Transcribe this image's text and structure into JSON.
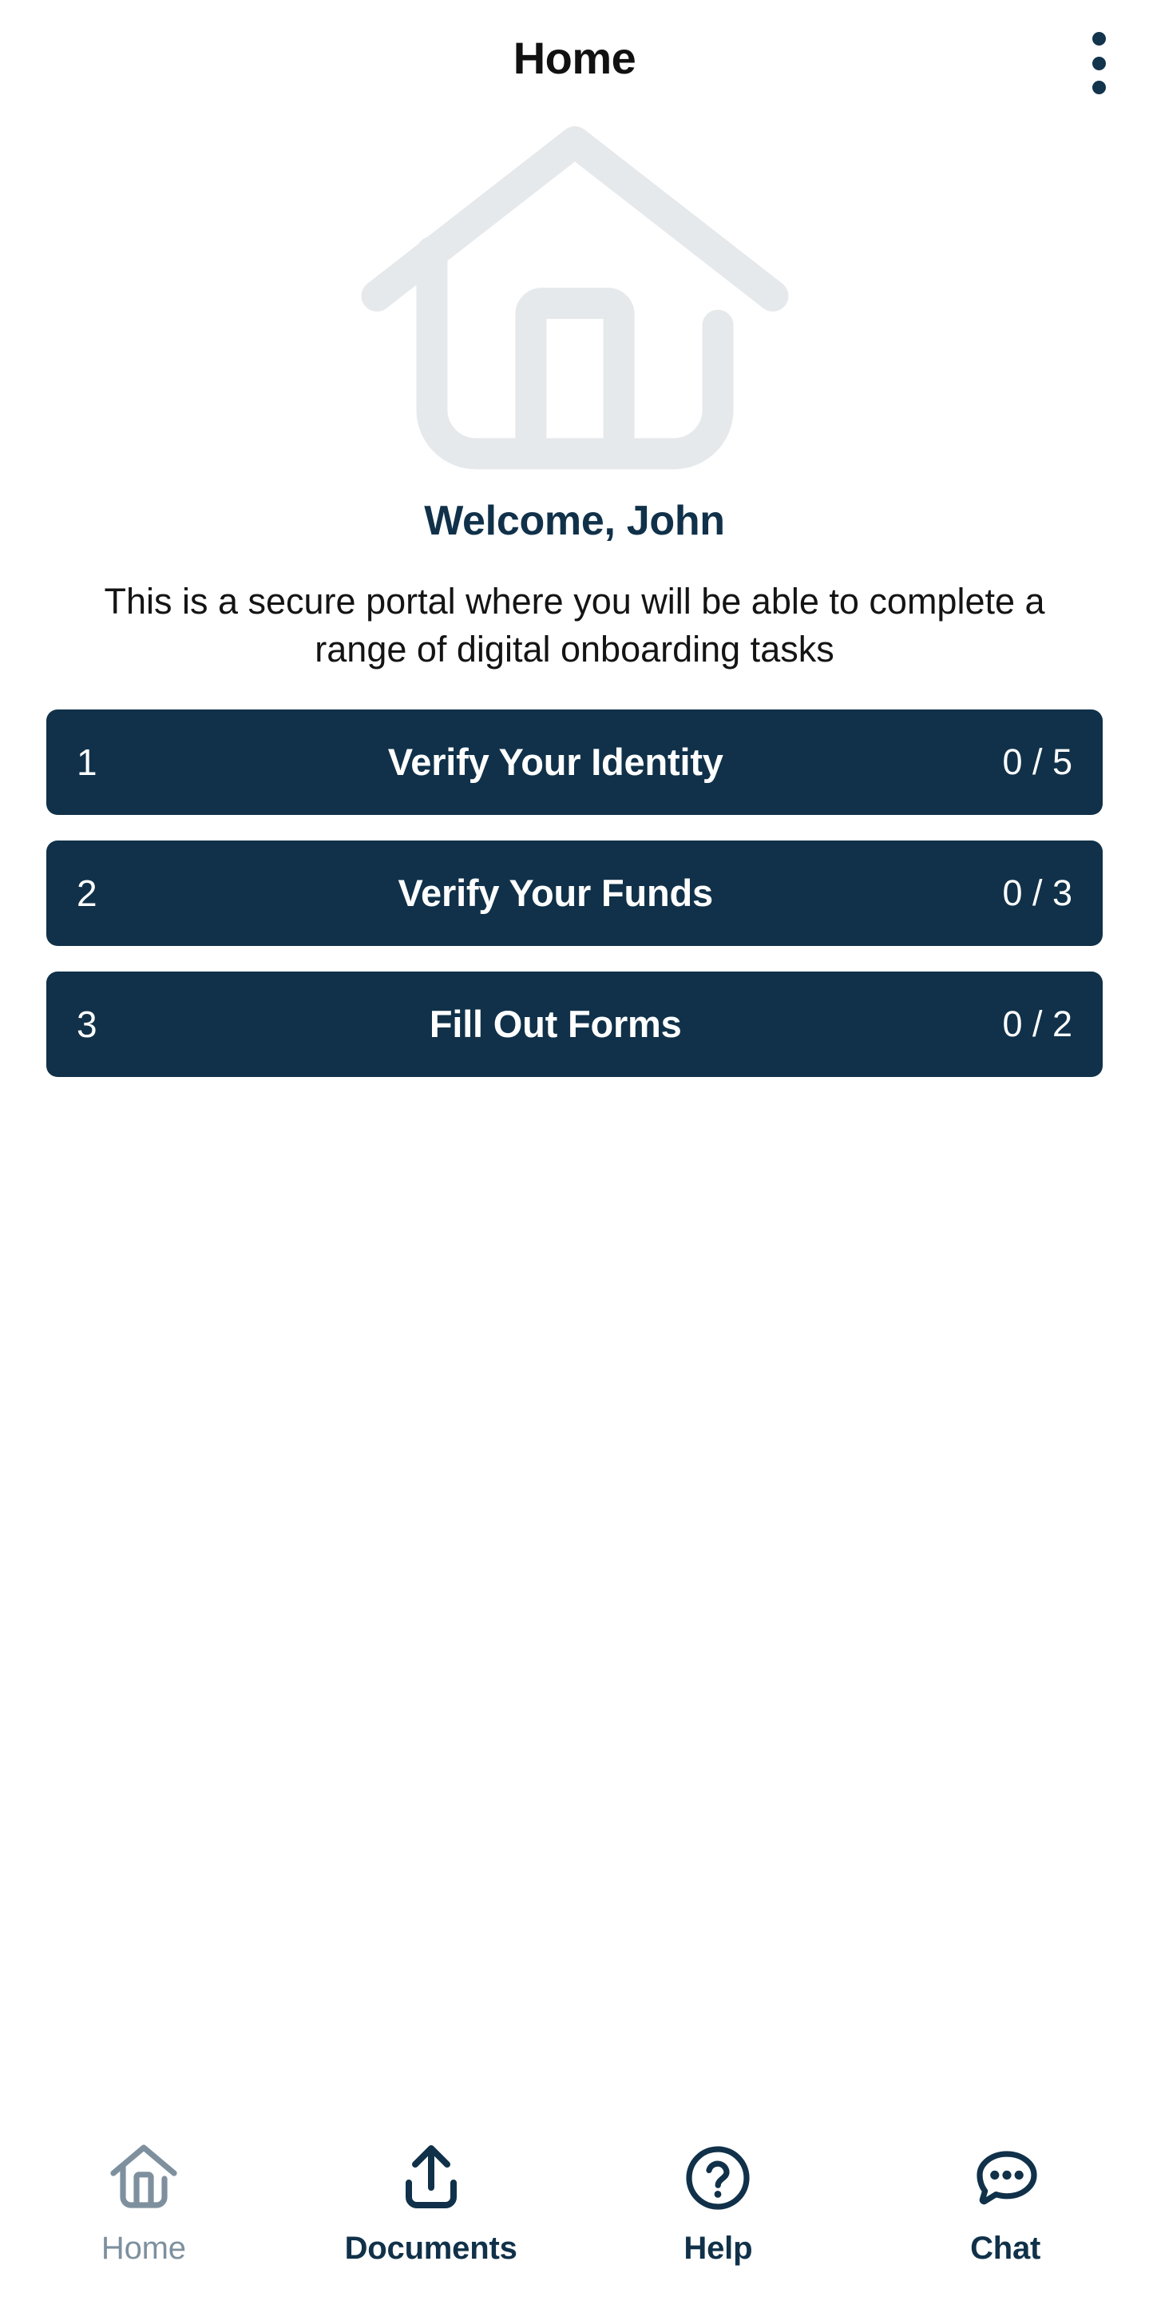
{
  "header": {
    "title": "Home",
    "menu_icon": "kebab-menu-icon"
  },
  "hero": {
    "icon": "house-outline-icon",
    "welcome": "Welcome, John",
    "description": "This is a secure portal where you will be able to complete a range of digital onboarding tasks"
  },
  "tasks": [
    {
      "index": "1",
      "title": "Verify Your Identity",
      "count": "0 / 5"
    },
    {
      "index": "2",
      "title": "Verify Your Funds",
      "count": "0 / 3"
    },
    {
      "index": "3",
      "title": "Fill Out Forms",
      "count": "0 / 2"
    }
  ],
  "bottom_nav": [
    {
      "label": "Home",
      "icon": "home-icon",
      "state": "muted"
    },
    {
      "label": "Documents",
      "icon": "upload-icon",
      "state": "dark"
    },
    {
      "label": "Help",
      "icon": "question-circle-icon",
      "state": "dark"
    },
    {
      "label": "Chat",
      "icon": "chat-bubble-icon",
      "state": "dark"
    }
  ],
  "colors": {
    "brand_navy": "#103149",
    "hero_icon_gray": "#e6e9eb",
    "nav_muted": "#7e909e",
    "card_text": "#ffffff",
    "page_background": "#ffffff"
  }
}
